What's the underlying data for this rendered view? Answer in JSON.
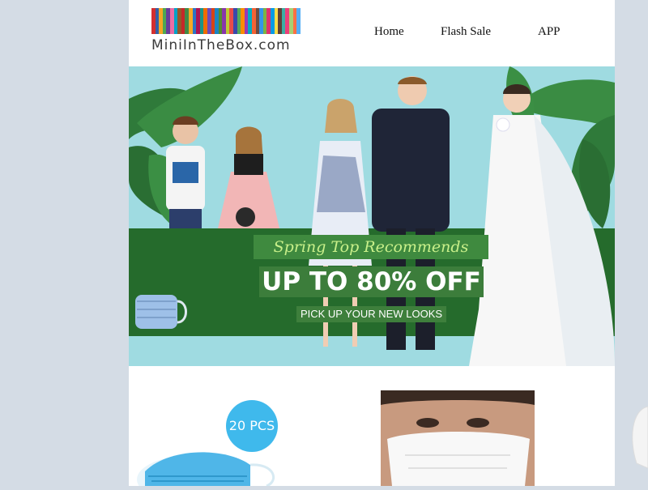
{
  "header": {
    "logo_text": "MiniInTheBox.com",
    "logo_stripe_colors": [
      "#d32f2f",
      "#1e4e9c",
      "#f6a623",
      "#3a9e3f",
      "#6a3d9a",
      "#e85d9b",
      "#00a2c7",
      "#8b4513",
      "#c62828",
      "#2e7d32",
      "#f9a825",
      "#1565c0",
      "#ad1457",
      "#00897b",
      "#ef6c00",
      "#5e35b1",
      "#d84315",
      "#0277bd",
      "#558b2f",
      "#7b1fa2",
      "#c0ca33",
      "#e53935",
      "#3949ab",
      "#43a047",
      "#fb8c00",
      "#8e24aa",
      "#00acc1",
      "#f4511e",
      "#6d4c41",
      "#1e88e5",
      "#7cb342",
      "#d81b60",
      "#039be5",
      "#fdd835",
      "#5d4037",
      "#26a69a",
      "#ec407a",
      "#9ccc65",
      "#ff7043",
      "#42a5f5"
    ]
  },
  "nav": {
    "items": [
      {
        "label": "Home"
      },
      {
        "label": "Flash Sale"
      },
      {
        "label": "APP"
      }
    ]
  },
  "banner": {
    "headline_script": "Spring Top Recommends",
    "discount": "UP TO 80% OFF",
    "cta": "PICK UP YOUR NEW LOOKS",
    "colors": {
      "sky": "#9fdbe1",
      "band": "#256b2c",
      "accent": "#c9f08a"
    }
  },
  "products": [
    {
      "badge": "20 PCS",
      "icon": "face-mask-blue-icon"
    },
    {
      "icon": "face-mask-white-model-icon"
    }
  ]
}
